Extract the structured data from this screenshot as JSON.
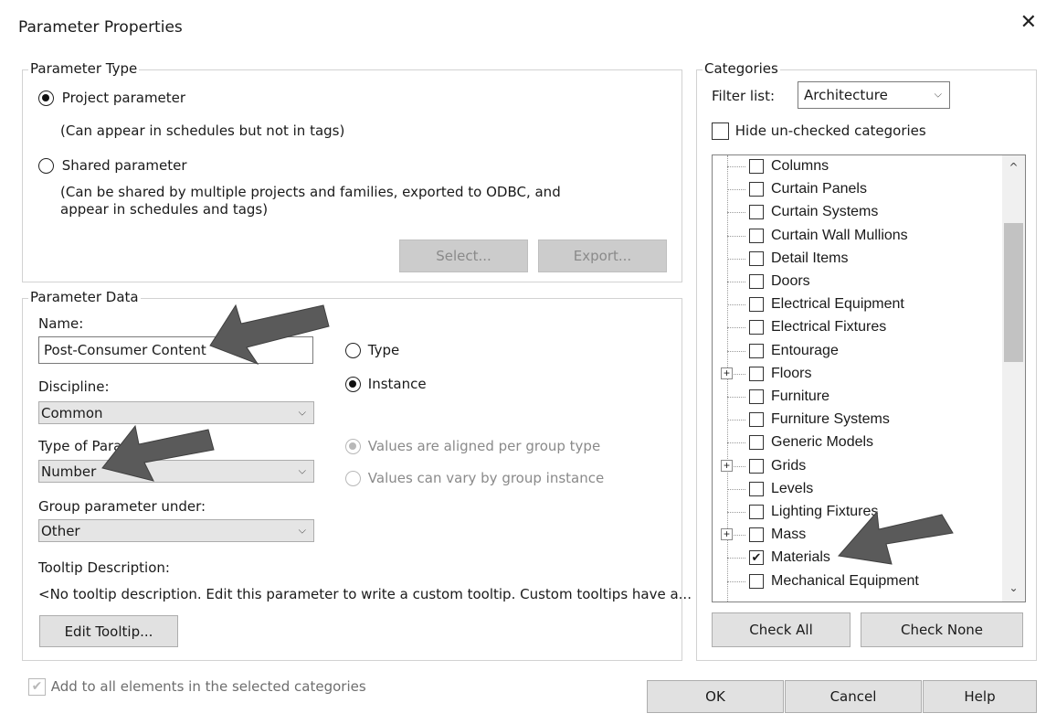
{
  "dialog": {
    "title": "Parameter Properties",
    "close_symbol": "✕"
  },
  "parameter_type": {
    "legend": "Parameter Type",
    "project_label": "Project parameter",
    "project_desc": "(Can appear in schedules but not in tags)",
    "shared_label": "Shared parameter",
    "shared_desc_line1": "(Can be shared by multiple projects and families, exported to ODBC, and",
    "shared_desc_line2": "appear in schedules and tags)",
    "select_button": "Select...",
    "export_button": "Export...",
    "selected": "project"
  },
  "parameter_data": {
    "legend": "Parameter Data",
    "name_label": "Name:",
    "name_value": "Post-Consumer Content",
    "type_option": "Type",
    "instance_option": "Instance",
    "type_instance_selected": "instance",
    "discipline_label": "Discipline:",
    "discipline_value": "Common",
    "type_of_param_label": "Type of Param",
    "type_of_param_value": "Number",
    "group_label": "Group parameter under:",
    "group_value": "Other",
    "values_aligned": "Values are aligned per group type",
    "values_vary": "Values can vary by group instance",
    "tooltip_label": "Tooltip Description:",
    "tooltip_text": "<No tooltip description. Edit this parameter to write a custom tooltip. Custom tooltips have a...",
    "edit_tooltip_button": "Edit Tooltip..."
  },
  "categories": {
    "legend": "Categories",
    "filter_label": "Filter list:",
    "filter_value": "Architecture",
    "hide_unchecked_label": "Hide un-checked categories",
    "items": [
      {
        "label": "Columns",
        "checked": false,
        "expandable": false
      },
      {
        "label": "Curtain Panels",
        "checked": false,
        "expandable": false
      },
      {
        "label": "Curtain Systems",
        "checked": false,
        "expandable": false
      },
      {
        "label": "Curtain Wall Mullions",
        "checked": false,
        "expandable": false
      },
      {
        "label": "Detail Items",
        "checked": false,
        "expandable": false
      },
      {
        "label": "Doors",
        "checked": false,
        "expandable": false
      },
      {
        "label": "Electrical Equipment",
        "checked": false,
        "expandable": false
      },
      {
        "label": "Electrical Fixtures",
        "checked": false,
        "expandable": false
      },
      {
        "label": "Entourage",
        "checked": false,
        "expandable": false
      },
      {
        "label": "Floors",
        "checked": false,
        "expandable": true
      },
      {
        "label": "Furniture",
        "checked": false,
        "expandable": false
      },
      {
        "label": "Furniture Systems",
        "checked": false,
        "expandable": false
      },
      {
        "label": "Generic Models",
        "checked": false,
        "expandable": false
      },
      {
        "label": "Grids",
        "checked": false,
        "expandable": true
      },
      {
        "label": "Levels",
        "checked": false,
        "expandable": false
      },
      {
        "label": "Lighting Fixtures",
        "checked": false,
        "expandable": false
      },
      {
        "label": "Mass",
        "checked": false,
        "expandable": true
      },
      {
        "label": "Materials",
        "checked": true,
        "expandable": false
      },
      {
        "label": "Mechanical Equipment",
        "checked": false,
        "expandable": false
      }
    ],
    "check_all_button": "Check All",
    "check_none_button": "Check None"
  },
  "footer": {
    "add_to_all_label": "Add to all elements in the selected categories",
    "ok_button": "OK",
    "cancel_button": "Cancel",
    "help_button": "Help"
  },
  "icons": {
    "expander_plus": "+",
    "chevron": "⌵",
    "scroll_up": "^",
    "scroll_down": "⌄",
    "check_mark": "✔"
  },
  "colors": {
    "annotation_arrow": "#5a5a5a"
  }
}
